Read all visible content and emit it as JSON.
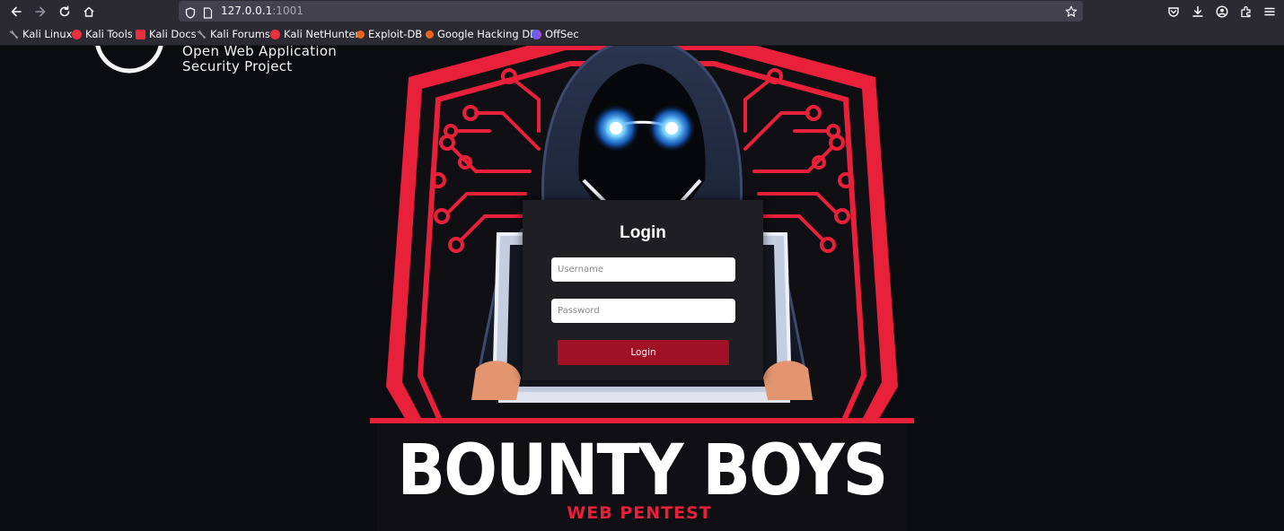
{
  "browser": {
    "url_host": "127.0.0.1",
    "url_port": ":1001",
    "bookmarks": [
      {
        "label": "Kali Linux",
        "icon": "kali-dragon-icon",
        "color": "#6a6a6a"
      },
      {
        "label": "Kali Tools",
        "icon": "kali-tools-icon",
        "color": "#e9313d"
      },
      {
        "label": "Kali Docs",
        "icon": "kali-docs-icon",
        "color": "#e9313d"
      },
      {
        "label": "Kali Forums",
        "icon": "kali-forums-icon",
        "color": "#6a6a6a"
      },
      {
        "label": "Kali NetHunter",
        "icon": "kali-nethunter-icon",
        "color": "#e9313d"
      },
      {
        "label": "Exploit-DB",
        "icon": "exploit-db-icon",
        "color": "#e8661a"
      },
      {
        "label": "Google Hacking DB",
        "icon": "ghdb-icon",
        "color": "#e8661a"
      },
      {
        "label": "OffSec",
        "icon": "offsec-icon",
        "color": "#4a6cf7"
      }
    ]
  },
  "owasp": {
    "line1": "Open Web Application",
    "line2": "Security Project"
  },
  "banner": {
    "title": "BOUNTY BOYS",
    "subtitle": "WEB PENTEST",
    "accent": "#e8203a"
  },
  "login": {
    "title": "Login",
    "username_placeholder": "Username",
    "password_placeholder": "Password",
    "button_label": "Login",
    "button_color": "#a01125"
  }
}
